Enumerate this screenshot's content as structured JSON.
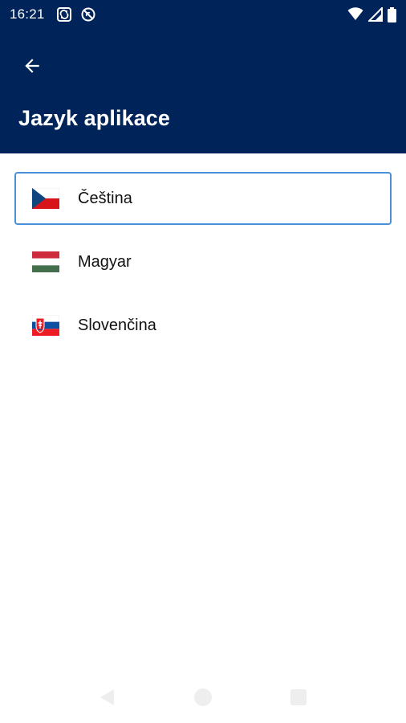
{
  "status_bar": {
    "time": "16:21",
    "left_icons": [
      "sync-icon",
      "blocked-icon"
    ],
    "right_icons": [
      "wifi-icon",
      "signal-icon",
      "battery-icon"
    ]
  },
  "app_bar": {
    "back_icon": "arrow-back-icon",
    "title": "Jazyk aplikace",
    "background_color": "#00245a"
  },
  "languages": {
    "items": [
      {
        "label": "Čeština",
        "flag": "flag-cz-icon",
        "selected": true
      },
      {
        "label": "Magyar",
        "flag": "flag-hu-icon",
        "selected": false
      },
      {
        "label": "Slovenčina",
        "flag": "flag-sk-icon",
        "selected": false
      }
    ],
    "selected_border_color": "#4a90d9"
  },
  "nav_bar": {
    "icons": [
      "nav-back-icon",
      "nav-home-icon",
      "nav-recents-icon"
    ]
  }
}
